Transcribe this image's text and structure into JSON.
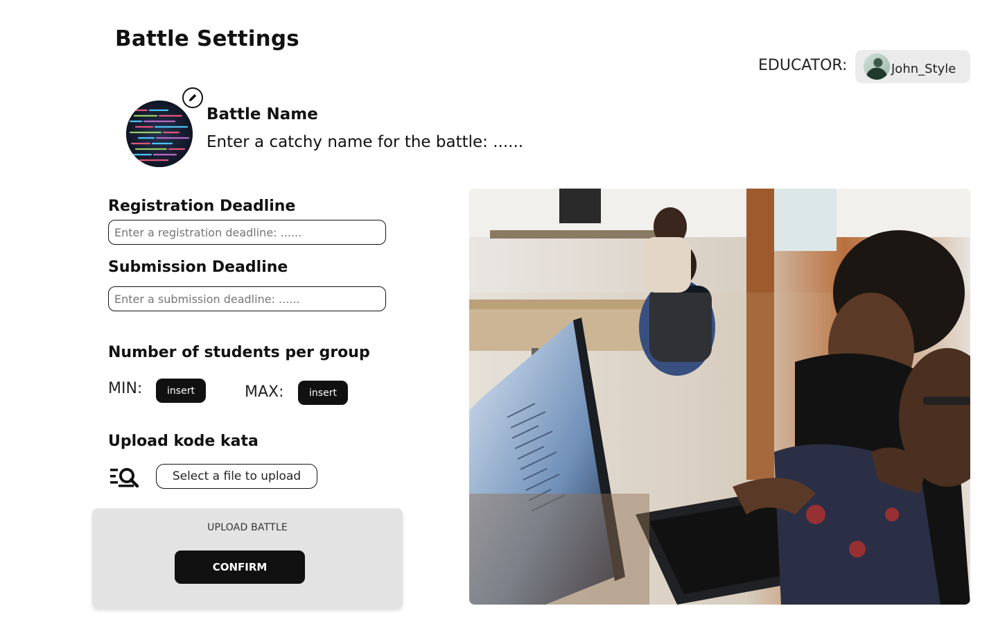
{
  "page": {
    "title": "Battle Settings"
  },
  "educator": {
    "label": "EDUCATOR:",
    "username": "John_Style"
  },
  "battle_name": {
    "label": "Battle Name",
    "value": "Enter a catchy name for the battle: ......"
  },
  "registration": {
    "label": "Registration Deadline",
    "placeholder": "Enter a registration deadline: ......"
  },
  "submission": {
    "label": "Submission Deadline",
    "placeholder": "Enter a submission deadline: ......"
  },
  "group_size": {
    "label": "Number of students per group",
    "min_label": "MIN:",
    "min_button": "insert",
    "max_label": "MAX:",
    "max_button": "insert"
  },
  "upload_kata": {
    "label": "Upload kode kata",
    "file_button": "Select a file to upload",
    "icon": "file-search-icon"
  },
  "upload_panel": {
    "title": "UPLOAD BATTLE",
    "confirm": "CONFIRM"
  },
  "icons": {
    "edit": "pencil-icon",
    "file_search": "file-search-icon"
  },
  "colors": {
    "primary": "#111111",
    "panel": "#e3e3e3",
    "chip": "#ebebeb"
  }
}
